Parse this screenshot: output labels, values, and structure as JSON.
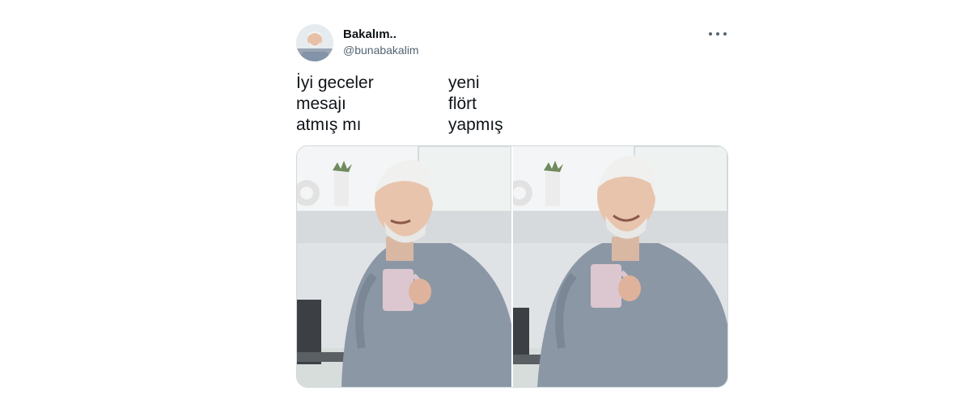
{
  "tweet": {
    "display_name": "Bakalım..",
    "handle": "@bunabakalim",
    "text_left": [
      "İyi geceler",
      "mesajı",
      "atmış mı"
    ],
    "text_right": [
      "yeni",
      "flört",
      "yapmış"
    ],
    "more_icon": "ellipsis-icon"
  },
  "colors": {
    "text": "#0f1419",
    "secondary": "#536471",
    "border": "#cfd9de"
  }
}
